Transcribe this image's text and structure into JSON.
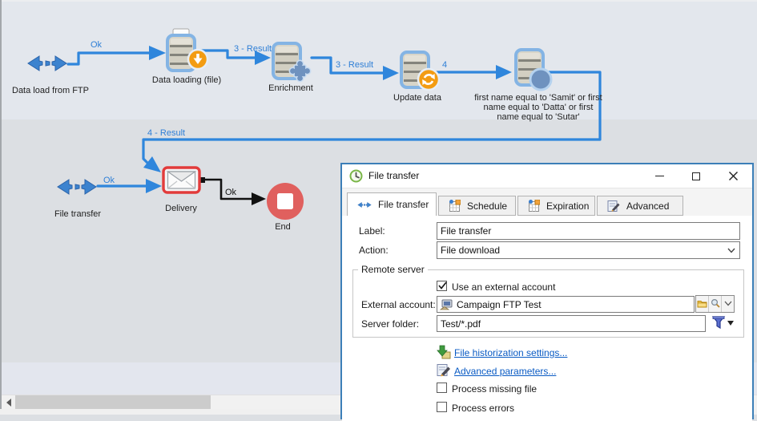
{
  "canvas": {
    "nodes": [
      {
        "label": "Data load from FTP"
      },
      {
        "label": "Data loading (file)"
      },
      {
        "label": "Enrichment"
      },
      {
        "label": "Update data"
      },
      {
        "label": "first name equal to 'Samit' or first name equal to 'Datta' or first name equal to 'Sutar'"
      },
      {
        "label": "File transfer"
      },
      {
        "label": "Delivery"
      },
      {
        "label": "End"
      }
    ],
    "connections": [
      {
        "label": "Ok"
      },
      {
        "label": "3 - Result"
      },
      {
        "label": "3 - Result"
      },
      {
        "label": "4"
      },
      {
        "label": "4 - Result"
      },
      {
        "label": "Ok"
      },
      {
        "label": "Ok"
      }
    ]
  },
  "dialog": {
    "title": "File transfer",
    "tabs": [
      {
        "label": "File transfer",
        "active": true
      },
      {
        "label": "Schedule",
        "active": false
      },
      {
        "label": "Expiration",
        "active": false
      },
      {
        "label": "Advanced",
        "active": false
      }
    ],
    "fields": {
      "label": {
        "label": "Label:",
        "value": "File transfer"
      },
      "action": {
        "label": "Action:",
        "value": "File download"
      },
      "group": {
        "legend": "Remote server"
      },
      "use_external_account": {
        "label": "Use an external account",
        "checked": true
      },
      "external_account": {
        "label": "External account:",
        "value": "Campaign FTP Test"
      },
      "server_folder": {
        "label": "Server folder:",
        "value": "Test/*.pdf"
      },
      "link_historization": "File historization settings...",
      "link_advanced": "Advanced parameters...",
      "process_missing_file": {
        "label": "Process missing file",
        "checked": false
      },
      "process_errors": {
        "label": "Process errors",
        "checked": false
      }
    }
  },
  "icons": {
    "node_ftp": "double-arrow-transfer-icon",
    "node_db": "database-icon",
    "badge_download": "download-arrow-icon",
    "badge_refresh": "refresh-icon",
    "badge_enrich": "puzzle-icon",
    "badge_query": "blue-circle-icon",
    "delivery": "envelope-icon",
    "end": "stop-icon"
  },
  "colors": {
    "connector_blue": "#2f86dc",
    "connector_black": "#111111",
    "selection_red": "#e23b3b",
    "end_red": "#e0605e",
    "badge_orange": "#f39c12",
    "link_blue": "#0a5bc4",
    "dialog_border_blue": "#3c7fb8"
  }
}
